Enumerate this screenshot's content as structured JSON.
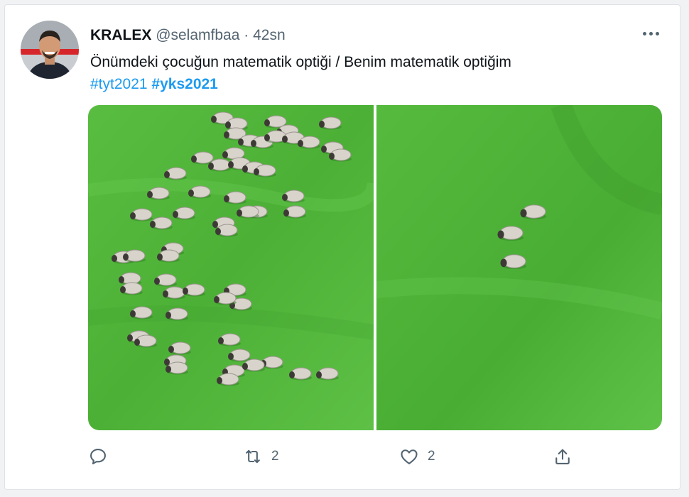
{
  "tweet": {
    "display_name": "KRALEX",
    "handle": "@selamfbaa",
    "time_separator": "·",
    "time": "42sn",
    "text": "Önümdeki çocuğun matematik optiği / Benim matematik optiğim",
    "hashtags": [
      "#tyt2021",
      "#yks2021"
    ]
  },
  "actions": {
    "reply_count": "",
    "retweet_count": "2",
    "like_count": "2"
  },
  "colors": {
    "link": "#1d9bf0",
    "secondary_text": "#536471",
    "grass": "#4fb43a"
  },
  "icons": {
    "more": "more-dots-icon",
    "reply": "reply-icon",
    "retweet": "retweet-icon",
    "like": "heart-icon",
    "share": "share-icon"
  }
}
